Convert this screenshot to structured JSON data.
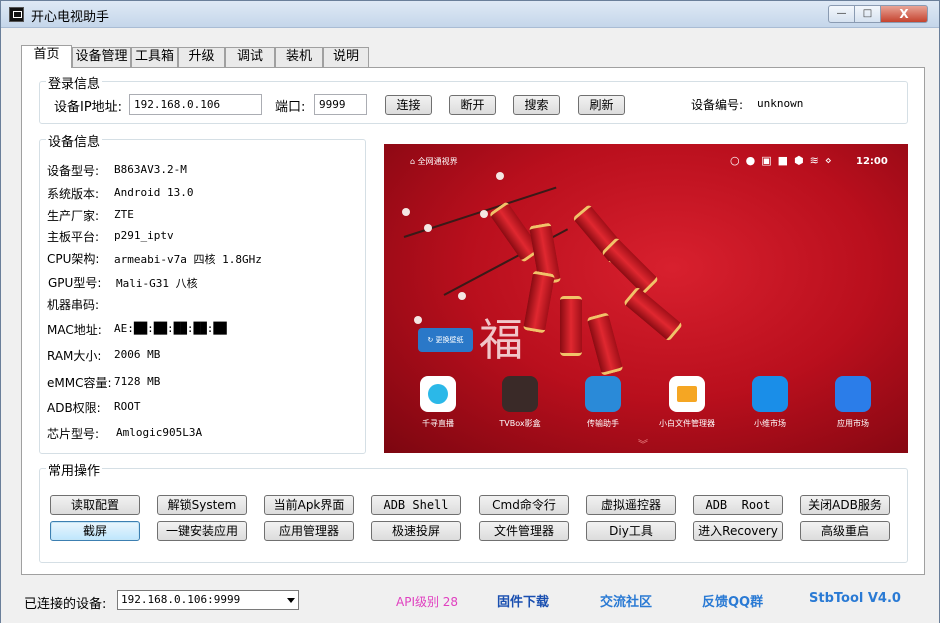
{
  "window": {
    "title": "开心电视助手",
    "min": "—",
    "max": "□",
    "close": "X"
  },
  "tabs": [
    "首页",
    "设备管理",
    "工具箱",
    "升级",
    "调试",
    "装机",
    "说明"
  ],
  "login": {
    "group_title": "登录信息",
    "ip_label": "设备IP地址:",
    "ip_value": "192.168.0.106",
    "port_label": "端口:",
    "port_value": "9999",
    "connect": "连接",
    "disconnect": "断开",
    "search": "搜索",
    "refresh": "刷新",
    "device_id_label": "设备编号:",
    "device_id_value": "unknown"
  },
  "device_info": {
    "group_title": "设备信息",
    "rows": [
      {
        "label": "设备型号:",
        "value": "B863AV3.2-M"
      },
      {
        "label": "系统版本:",
        "value": "Android 13.0"
      },
      {
        "label": "生产厂家:",
        "value": "ZTE"
      },
      {
        "label": "主板平台:",
        "value": "p291_iptv"
      },
      {
        "label": "CPU架构:",
        "value": "armeabi-v7a 四核 1.8GHz"
      },
      {
        "label": "GPU型号:",
        "value": "Mali-G31 八核"
      },
      {
        "label": "机器串码:",
        "value": ""
      },
      {
        "label": "MAC地址:",
        "value": "AE:██:██:██:██:██"
      },
      {
        "label": "RAM大小:",
        "value": "2006 MB"
      },
      {
        "label": "eMMC容量:",
        "value": "7128 MB"
      },
      {
        "label": "ADB权限:",
        "value": "ROOT"
      },
      {
        "label": "芯片型号:",
        "value": "Amlogic905L3A"
      }
    ]
  },
  "tv_screen": {
    "home_label": "全网通视界",
    "time": "12:00",
    "wallpaper_button": "更换壁纸",
    "apps": [
      {
        "name": "千寻直播",
        "color": "#ffffff",
        "icon": "play-icon"
      },
      {
        "name": "TVBox影盒",
        "color": "#3a2a28",
        "icon": "box-icon"
      },
      {
        "name": "传输助手",
        "color": "#2a8ad8",
        "icon": "folder-transfer-icon"
      },
      {
        "name": "小白文件管理器",
        "color": "#ffffff",
        "icon": "file-manager-icon"
      },
      {
        "name": "小维市场",
        "color": "#1a8ee8",
        "icon": "shopping-bag-icon"
      },
      {
        "name": "应用市场",
        "color": "#2b7de9",
        "icon": "app-grid-icon"
      }
    ]
  },
  "ops": {
    "group_title": "常用操作",
    "row1": [
      "读取配置",
      "解锁System",
      "当前Apk界面",
      "ADB Shell",
      "Cmd命令行",
      "虚拟遥控器",
      "ADB  Root",
      "关闭ADB服务"
    ],
    "row2": [
      "截屏",
      "一键安装应用",
      "应用管理器",
      "极速投屏",
      "文件管理器",
      "Diy工具",
      "进入Recovery",
      "高级重启"
    ]
  },
  "status": {
    "connected_label": "已连接的设备:",
    "connected_value": "192.168.0.106:9999",
    "api_level": "API级别 28",
    "firmware": "固件下载",
    "community": "交流社区",
    "feedback": "反馈QQ群",
    "version": "StbTool V4.0"
  },
  "colors": {
    "api": "#e040c0",
    "link": "#2a7ad4",
    "firmware": "#1a4fb0"
  }
}
